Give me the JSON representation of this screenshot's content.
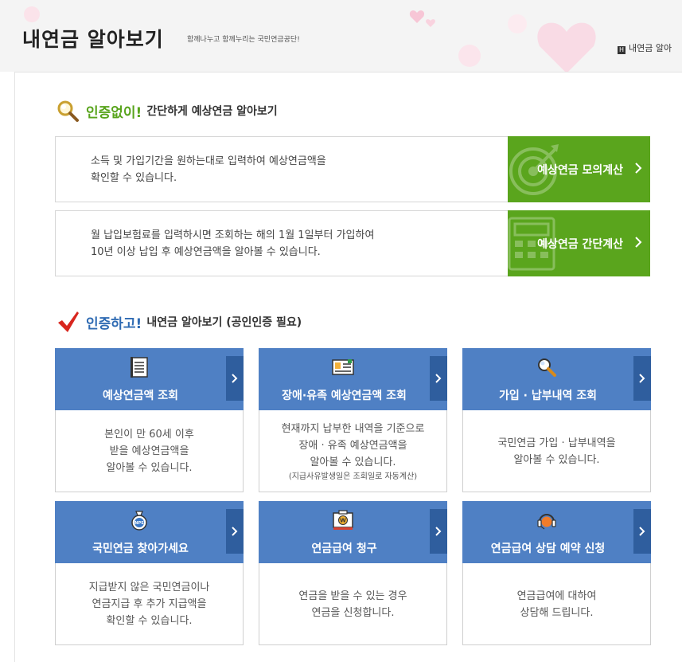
{
  "header": {
    "title": "내연금 알아보기",
    "slogan": "함께나누고 함께누리는 국민연금공단!",
    "breadcrumb_home": "H",
    "breadcrumb": "내연금 알아"
  },
  "section_no_auth": {
    "strong": "인증없이!",
    "sub": "간단하게 예상연금 알아보기",
    "rows": [
      {
        "line1": "소득 및 가입기간을 원하는대로 입력하여 예상연금액을",
        "line2": "확인할 수 있습니다.",
        "button": "예상연금 모의계산"
      },
      {
        "line1": "월 납입보험료를 입력하시면 조회하는 해의 1월 1일부터 가입하여",
        "line2": "10년 이상 납입 후 예상연금액을 알아볼 수 있습니다.",
        "button": "예상연금 간단계산"
      }
    ]
  },
  "section_auth": {
    "strong": "인증하고!",
    "sub": "내연금 알아보기 (공인인증 필요)",
    "cards": [
      {
        "icon": "document-list-icon",
        "title": "예상연금액 조회",
        "lines": [
          "본인이 만 60세 이후",
          "받을 예상연금액을",
          "알아볼 수 있습니다."
        ],
        "note": ""
      },
      {
        "icon": "id-card-icon",
        "title": "장애·유족 예상연금액 조회",
        "lines": [
          "현재까지 납부한 내역을 기준으로",
          "장애 · 유족 예상연금액을",
          "알아볼 수 있습니다."
        ],
        "note": "(지급사유발생일은 조회일로 자동계산)"
      },
      {
        "icon": "magnifier-icon",
        "title": "가입 · 납부내역 조회",
        "lines": [
          "국민연금 가입 · 납부내역을",
          "알아볼 수 있습니다."
        ],
        "note": ""
      },
      {
        "icon": "money-bag-icon",
        "title": "국민연금 찾아가세요",
        "lines": [
          "지급받지 않은 국민연금이나",
          "연금지급 후 추가 지급액을",
          "확인할 수 있습니다."
        ],
        "note": "",
        "badge": "NPS"
      },
      {
        "icon": "payment-terminal-icon",
        "title": "연금급여 청구",
        "lines": [
          "연금을 받을 수 있는 경우",
          "연금을 신청합니다."
        ],
        "note": "",
        "badge": "W"
      },
      {
        "icon": "headset-icon",
        "title": "연금급여 상담 예약 신청",
        "lines": [
          "연금급여에 대하여",
          "상담해 드립니다."
        ],
        "note": ""
      }
    ]
  },
  "colors": {
    "green": "#5aa51d",
    "blue": "#4f80c4",
    "blue_dark": "#2f5e9e",
    "heading_green": "#58a41c",
    "heading_blue": "#2f6bb3"
  }
}
